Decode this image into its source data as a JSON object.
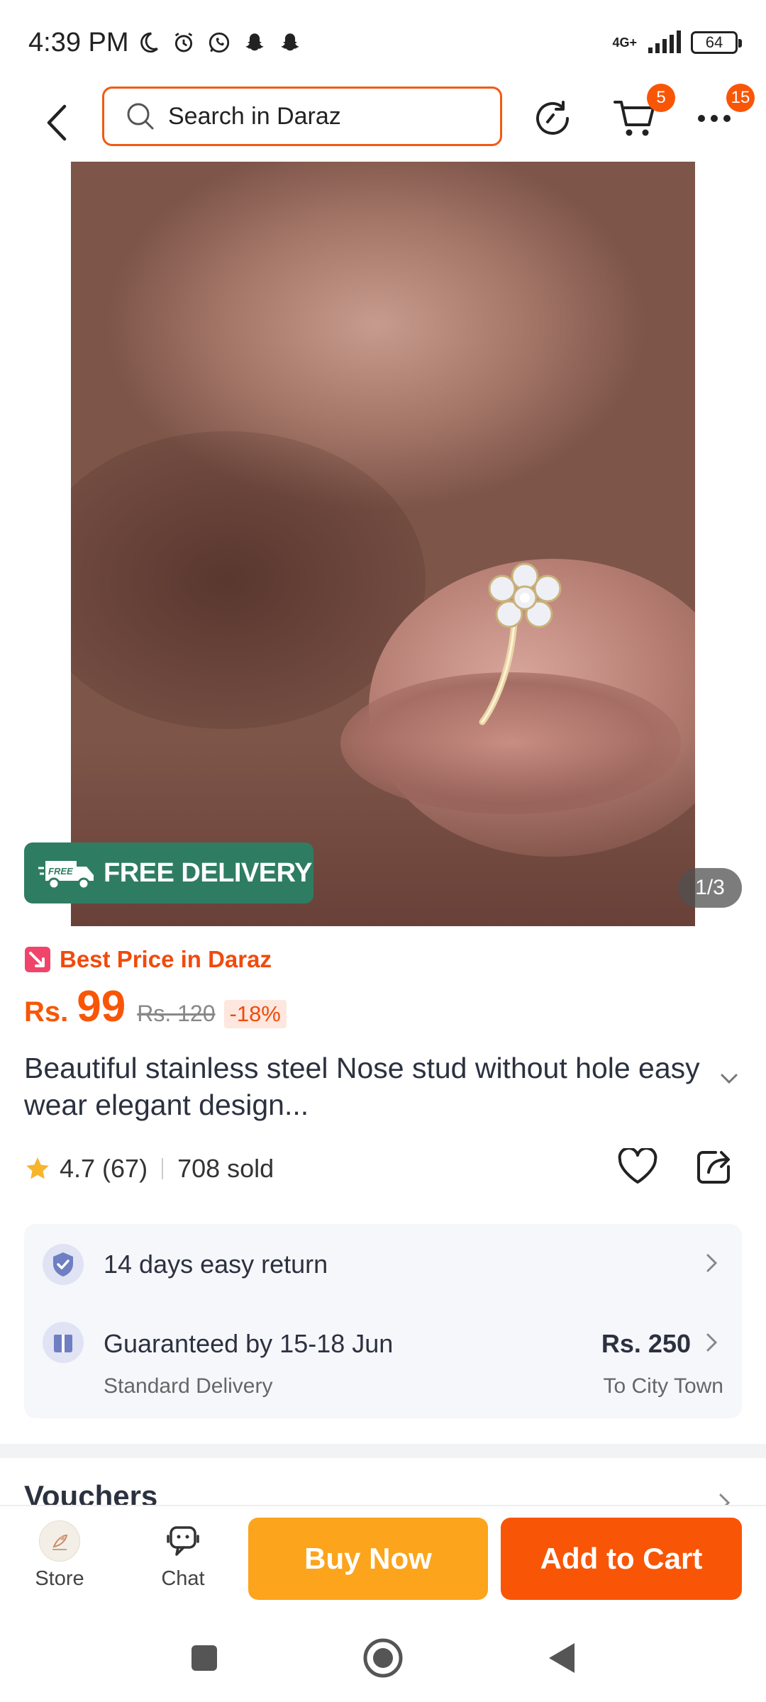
{
  "status_bar": {
    "time": "4:39 PM",
    "network": "4G+",
    "battery": "64",
    "icons": [
      "moon-icon",
      "alarm-icon",
      "whatsapp-icon",
      "snapchat-icon",
      "snapchat-icon",
      "signal-icon",
      "battery-icon"
    ]
  },
  "top_nav": {
    "search_placeholder": "Search in Daraz",
    "cart_badge": "5",
    "more_badge": "15"
  },
  "gallery": {
    "free_delivery_tag": "FREE",
    "free_delivery_label": "FREE DELIVERY",
    "counter": "1/3"
  },
  "product": {
    "best_price_label": "Best Price in Daraz",
    "price_currency": "Rs.",
    "price_value": "99",
    "original_price": "Rs. 120",
    "discount": "-18%",
    "title": "Beautiful stainless steel Nose stud without hole easy wear elegant design...",
    "rating": "4.7",
    "rating_count": "(67)",
    "sold": "708 sold"
  },
  "services": {
    "return_label": "14 days easy return",
    "delivery_label": "Guaranteed by 15-18 Jun",
    "delivery_type": "Standard Delivery",
    "delivery_fee": "Rs. 250",
    "delivery_location": "To City Town"
  },
  "vouchers": {
    "title": "Vouchers"
  },
  "action_bar": {
    "store_label": "Store",
    "chat_label": "Chat",
    "buy_now_label": "Buy Now",
    "add_to_cart_label": "Add to Cart"
  },
  "colors": {
    "brand_orange": "#f85606",
    "buy_now_yellow": "#fca41b",
    "free_delivery_green": "#2e7d63",
    "rating_star": "#f7b52c"
  }
}
